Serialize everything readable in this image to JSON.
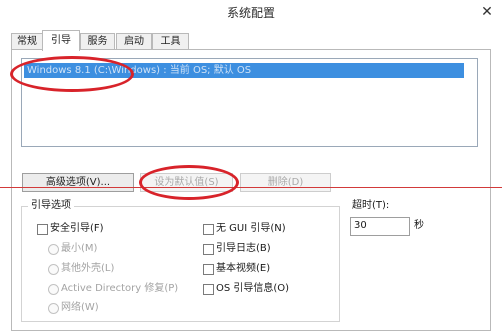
{
  "window": {
    "title": "系统配置",
    "close_glyph": "✕"
  },
  "tabs": [
    {
      "label": "常规",
      "active": false
    },
    {
      "label": "引导",
      "active": true
    },
    {
      "label": "服务",
      "active": false
    },
    {
      "label": "启动",
      "active": false
    },
    {
      "label": "工具",
      "active": false
    }
  ],
  "os_list": [
    {
      "label": "Windows 8.1 (C:\\Windows) : 当前 OS; 默认 OS",
      "selected": true
    }
  ],
  "buttons": {
    "advanced": "高级选项(V)...",
    "set_default": "设为默认值(S)",
    "delete": "删除(D)"
  },
  "boot_options": {
    "group_label": "引导选项",
    "safe_boot": {
      "label": "安全引导(F)",
      "checked": false
    },
    "radios": [
      {
        "label": "最小(M)",
        "enabled": false
      },
      {
        "label": "其他外壳(L)",
        "enabled": false
      },
      {
        "label": "Active Directory 修复(P)",
        "enabled": false
      },
      {
        "label": "网络(W)",
        "enabled": false
      }
    ],
    "checkboxes": [
      {
        "label": "无 GUI 引导(N)",
        "checked": false
      },
      {
        "label": "引导日志(B)",
        "checked": false
      },
      {
        "label": "基本视频(E)",
        "checked": false
      },
      {
        "label": "OS 引导信息(O)",
        "checked": false
      }
    ]
  },
  "timeout": {
    "label": "超时(T):",
    "value": "30",
    "unit": "秒"
  },
  "colors": {
    "selection": "#3d8fe0",
    "annotation_red": "#d8232a"
  }
}
